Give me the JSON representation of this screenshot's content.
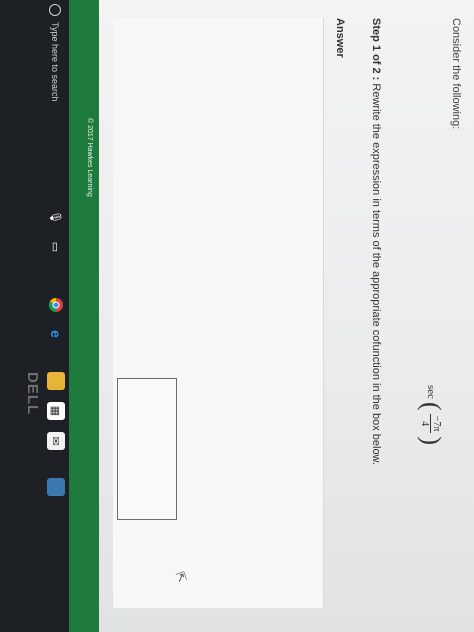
{
  "problem": {
    "prompt": "Consider the following:",
    "expression": {
      "function": "sec",
      "numerator": "−7π",
      "denominator": "4"
    },
    "step_label": "Step 1 of 2 :",
    "step_text": "Rewrite the expression in terms of the appropriate cofunction in the box below."
  },
  "answer": {
    "label": "Answer"
  },
  "footer": {
    "copyright": "© 2017 Hawkes Learning"
  },
  "taskbar": {
    "search_placeholder": "Type here to search"
  },
  "branding": {
    "device_logo": "DELL"
  },
  "colors": {
    "footer_green": "#1f7a3d",
    "taskbar_bg": "#1d2024"
  },
  "icons": [
    "mic-icon",
    "task-view-icon",
    "chrome-icon",
    "edge-icon",
    "file-explorer-icon",
    "store-icon",
    "mail-icon",
    "python-icon"
  ]
}
